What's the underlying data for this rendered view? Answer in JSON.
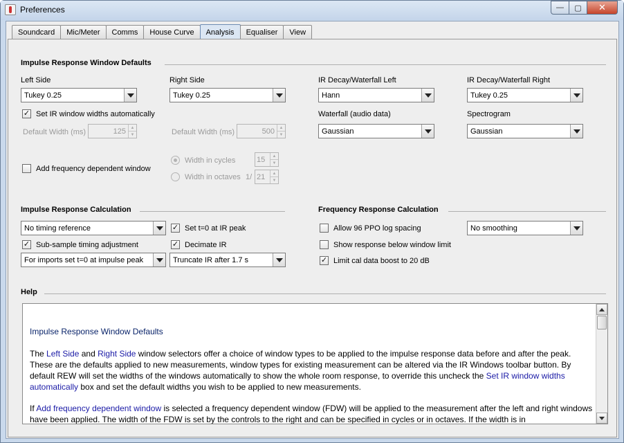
{
  "window": {
    "title": "Preferences",
    "icon": "rew-app-icon"
  },
  "caption": {
    "minimize": "—",
    "maximize": "▢",
    "close": "✕"
  },
  "tabs": [
    "Soundcard",
    "Mic/Meter",
    "Comms",
    "House Curve",
    "Analysis",
    "Equaliser",
    "View"
  ],
  "active_tab": "Analysis",
  "irwd": {
    "title": "Impulse Response Window Defaults",
    "left_side_label": "Left Side",
    "left_side_value": "Tukey 0.25",
    "right_side_label": "Right Side",
    "right_side_value": "Tukey 0.25",
    "decay_left_label": "IR Decay/Waterfall Left",
    "decay_left_value": "Hann",
    "decay_right_label": "IR Decay/Waterfall Right",
    "decay_right_value": "Tukey 0.25",
    "waterfall_label": "Waterfall (audio data)",
    "waterfall_value": "Gaussian",
    "spectrogram_label": "Spectrogram",
    "spectrogram_value": "Gaussian",
    "set_auto_label": "Set IR window widths automatically",
    "set_auto_checked": true,
    "default_width_left_label": "Default Width (ms)",
    "default_width_left_value": "125",
    "default_width_right_label": "Default Width (ms)",
    "default_width_right_value": "500",
    "fdw_label": "Add frequency dependent window",
    "fdw_checked": false,
    "width_cycles_label": "Width in cycles",
    "width_cycles_value": "15",
    "width_octaves_label": "Width in octaves",
    "width_octaves_prefix": "1/",
    "width_octaves_value": "21"
  },
  "irc": {
    "title": "Impulse Response Calculation",
    "timing_ref_value": "No timing reference",
    "set_t0_label": "Set t=0 at IR peak",
    "set_t0_checked": true,
    "subsample_label": "Sub-sample timing adjustment",
    "subsample_checked": true,
    "decimate_label": "Decimate IR",
    "decimate_checked": true,
    "imports_value": "For imports set t=0 at impulse peak",
    "truncate_value": "Truncate IR after 1.7 s"
  },
  "frc": {
    "title": "Frequency Response Calculation",
    "ppo_label": "Allow 96 PPO log spacing",
    "ppo_checked": false,
    "smoothing_value": "No  smoothing",
    "below_limit_label": "Show response below window limit",
    "below_limit_checked": false,
    "cal_boost_label": "Limit cal data boost to 20 dB",
    "cal_boost_checked": true
  },
  "help": {
    "title": "Help",
    "heading": "Impulse Response Window Defaults",
    "p1_a": "The ",
    "p1_kw1": "Left Side",
    "p1_b": " and ",
    "p1_kw2": "Right Side",
    "p1_c": " window selectors offer a choice of window types to be applied to the impulse response data before and after the peak. These are the defaults applied to new measurements, window types for existing measurement can be altered via the IR Windows toolbar button. By default REW will set the widths of the windows automatically to show the whole room response, to override this uncheck the ",
    "p1_kw3": "Set IR window widths automatically",
    "p1_d": " box and set the default widths you wish to be applied to new measurements.",
    "p2_a": "If ",
    "p2_kw1": "Add frequency dependent window",
    "p2_b": " is selected a frequency dependent window (FDW) will be applied to the measurement after the left and right windows have been applied. The width of the FDW is set by the controls to the right and can be specified in cycles or in octaves. If the width is in"
  },
  "colors": {
    "link_blue": "#1a1aa6",
    "help_heading": "#0a246a",
    "tab_active": "#dbe6f3"
  }
}
